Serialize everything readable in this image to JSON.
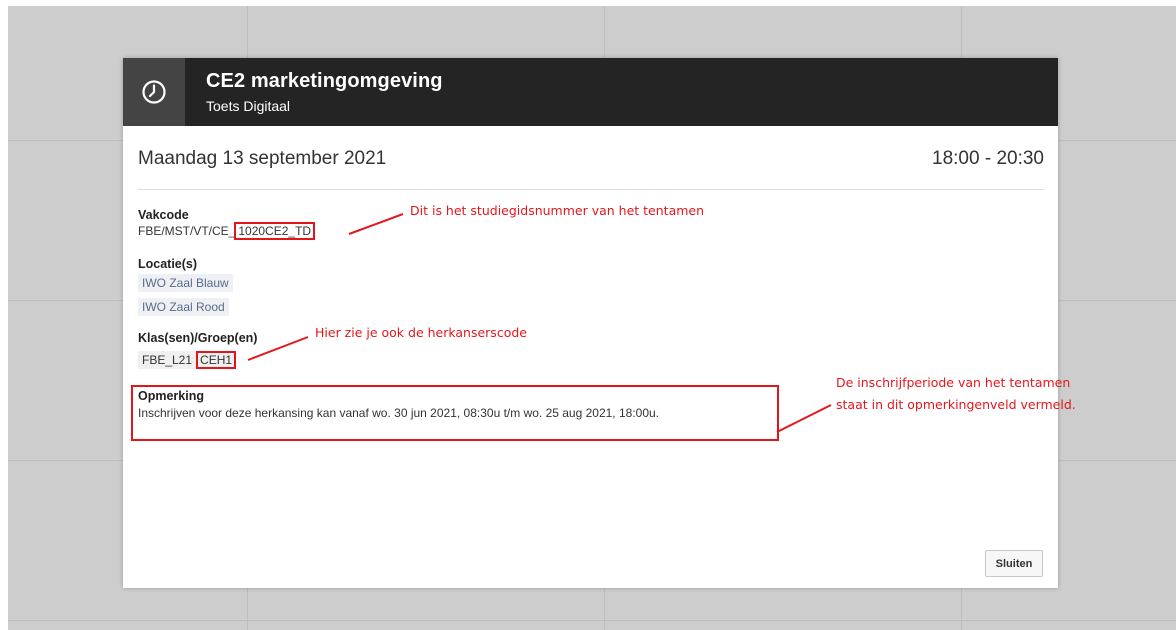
{
  "modal": {
    "title": "CE2 marketingomgeving",
    "subtitle": "Toets Digitaal",
    "date": "Maandag 13 september 2021",
    "time": "18:00 - 20:30",
    "vakcode": {
      "label": "Vakcode",
      "prefix": "FBE/MST/VT/CE_",
      "code": "1020CE2_TD"
    },
    "locaties": {
      "label": "Locatie(s)",
      "items": [
        "IWO Zaal Blauw",
        "IWO Zaal Rood"
      ]
    },
    "klassen": {
      "label": "Klas(sen)/Groep(en)",
      "items": [
        "FBE_L21",
        "CEH1"
      ]
    },
    "opmerking": {
      "label": "Opmerking",
      "text": "Inschrijven voor deze herkansing kan vanaf wo. 30 jun 2021, 08:30u t/m wo. 25 aug 2021, 18:00u."
    },
    "close_label": "Sluiten"
  },
  "annotations": {
    "vakcode_note": "Dit is het studiegidsnummer van het tentamen",
    "klas_note": "Hier zie je ook de herkanserscode",
    "remark_note_line1": "De inschrijfperiode van het tentamen",
    "remark_note_line2": "staat in dit opmerkingenveld vermeld."
  },
  "colors": {
    "header_bg": "#242424",
    "annotation_red": "#e3171c",
    "backdrop": "#cdcdcd"
  },
  "icons": {
    "header": "clock-icon"
  }
}
